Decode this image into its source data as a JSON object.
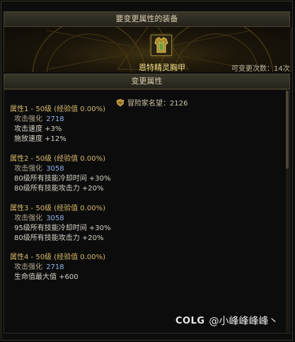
{
  "header": {
    "title": "要变更属性的装备"
  },
  "equipment": {
    "name": "恩特精灵胸甲",
    "change_count": "可变更次数：14次",
    "icon": "chest-armor-icon"
  },
  "section": {
    "title": "变更属性"
  },
  "reputation": {
    "text": "冒险家名望：2126",
    "icon": "reputation-crest-icon"
  },
  "attributes": [
    {
      "title": "属性1 - 50级 (经验值 0.00%)",
      "main_label": "攻击强化",
      "main_value": "2718",
      "lines": [
        "攻击速度 +3%",
        "施放速度 +12%"
      ]
    },
    {
      "title": "属性2 - 50级 (经验值 0.00%)",
      "main_label": "攻击强化",
      "main_value": "3058",
      "lines": [
        "80级所有技能冷却时间 +30%",
        "80级所有技能攻击力 +20%"
      ]
    },
    {
      "title": "属性3 - 50级 (经验值 0.00%)",
      "main_label": "攻击强化",
      "main_value": "3058",
      "lines": [
        "95级所有技能冷却时间 +30%",
        "80级所有技能攻击力 +20%"
      ]
    },
    {
      "title": "属性4 - 50级 (经验值 0.00%)",
      "main_label": "攻击强化",
      "main_value": "2718",
      "lines": [
        "生命值最大值 +600"
      ]
    }
  ],
  "watermark": {
    "logo": "COLG",
    "user": "@小峰峰峰峰丶"
  },
  "colors": {
    "accent_gold": "#f1e08a",
    "value_blue": "#8fb2e8",
    "title_tan": "#d4b96a"
  }
}
